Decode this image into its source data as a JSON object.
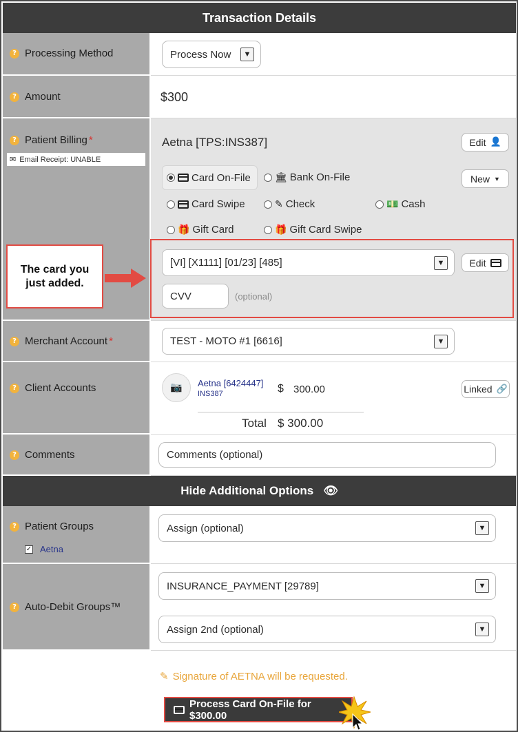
{
  "header": {
    "title": "Transaction Details"
  },
  "processing_method": {
    "label": "Processing Method",
    "value": "Process Now"
  },
  "amount": {
    "label": "Amount",
    "value": "$300"
  },
  "patient_billing": {
    "label": "Patient Billing",
    "email_receipt": "Email Receipt: UNABLE",
    "payer": "Aetna  [TPS:INS387]",
    "edit_label": "Edit",
    "new_label": "New",
    "options": {
      "card_on_file": "Card On-File",
      "bank_on_file": "Bank On-File",
      "card_swipe": "Card Swipe",
      "check": "Check",
      "cash": "Cash",
      "gift_card": "Gift Card",
      "gift_card_swipe": "Gift Card Swipe"
    },
    "selected_option": "card_on_file",
    "card_value": "[VI] [X1111] [01/23] [485]",
    "card_edit_label": "Edit",
    "cvv_placeholder": "CVV",
    "cvv_optional": "(optional)"
  },
  "callout": {
    "text": "The card you just added."
  },
  "merchant_account": {
    "label": "Merchant Account",
    "value": "TEST - MOTO #1 [6616]"
  },
  "client_accounts": {
    "label": "Client Accounts",
    "account_name": "Aetna [6424447]",
    "account_sub": "INS387",
    "currency": "$",
    "amount": "300.00",
    "linked_label": "Linked",
    "total_label": "Total",
    "total_value": "$ 300.00"
  },
  "comments": {
    "label": "Comments",
    "placeholder": "Comments (optional)"
  },
  "additional": {
    "title": "Hide Additional Options"
  },
  "patient_groups": {
    "label": "Patient Groups",
    "group": "Aetna",
    "select": "Assign (optional)"
  },
  "auto_debit": {
    "label": "Auto-Debit Groups™",
    "primary": "INSURANCE_PAYMENT [29789]",
    "secondary": "Assign 2nd (optional)"
  },
  "signature_note": "Signature of AETNA will be requested.",
  "process_button": "Process Card On-File for $300.00",
  "colors": {
    "accent_red": "#e24b43",
    "header_bg": "#3c3c3c",
    "label_bg": "#a9a9a9",
    "question_icon": "#f2b33d",
    "signature_note": "#e8a53a"
  }
}
